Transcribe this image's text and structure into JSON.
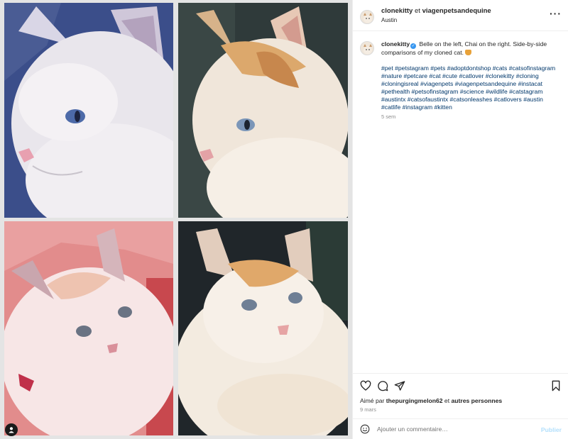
{
  "header": {
    "username": "clonekitty",
    "connector": " et ",
    "collaborator": "viagenpetsandequine",
    "location": "Austin",
    "more_icon": "more-horizontal-icon"
  },
  "caption": {
    "username": "clonekitty",
    "text": "Belle on the left, Chai on the right. Side-by-side comparisons of my cloned cat.",
    "hashtags": [
      "#pet",
      "#petstagram",
      "#pets",
      "#adoptdontshop",
      "#cats",
      "#catsofinstagram",
      "#nature",
      "#petcare",
      "#cat",
      "#cute",
      "#catlover",
      "#clonekitty",
      "#cloning",
      "#cloningisreal",
      "#viagenpets",
      "#viagenpetsandequine",
      "#instacat",
      "#pethealth",
      "#petsofinstagram",
      "#science",
      "#wildlife",
      "#catstagram",
      "#austintx",
      "#catsofaustintx",
      "#catsonleashes",
      "#catlovers",
      "#austin",
      "#catlife",
      "#instagram",
      "#kitten"
    ],
    "time": "5 sem"
  },
  "likes": {
    "prefix": "Aimé par ",
    "user": "thepurgingmelon62",
    "middle": " et ",
    "others": "autres personnes"
  },
  "post_date": "9 mars",
  "comment": {
    "placeholder": "Ajouter un commentaire…",
    "publish_label": "Publier"
  },
  "colors": {
    "link": "#00376b",
    "muted": "#8e8e8e",
    "verified": "#3897f0",
    "publish_disabled": "#b2dffc"
  }
}
